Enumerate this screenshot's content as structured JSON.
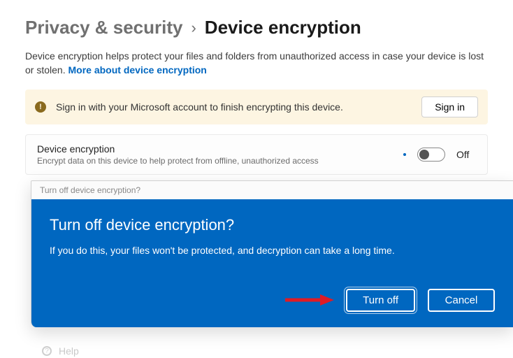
{
  "breadcrumb": {
    "parent": "Privacy & security",
    "separator": "›",
    "current": "Device encryption"
  },
  "description": {
    "text": "Device encryption helps protect your files and folders from unauthorized access in case your device is lost or stolen. ",
    "link_label": "More about device encryption"
  },
  "infobar": {
    "icon_glyph": "!",
    "message": "Sign in with your Microsoft account to finish encrypting this device.",
    "button_label": "Sign in"
  },
  "setting": {
    "title": "Device encryption",
    "subtitle": "Encrypt data on this device to help protect from offline, unauthorized access",
    "state_label": "Off"
  },
  "dialog": {
    "titlebar": "Turn off device encryption?",
    "heading": "Turn off device encryption?",
    "message": "If you do this, your files won't be protected, and decryption can take a long time.",
    "primary_label": "Turn off",
    "secondary_label": "Cancel"
  },
  "footer": {
    "help_label": "Help"
  },
  "colors": {
    "accent": "#0067c0",
    "infobar_bg": "#fdf5e2",
    "annotation": "#e01b24"
  }
}
